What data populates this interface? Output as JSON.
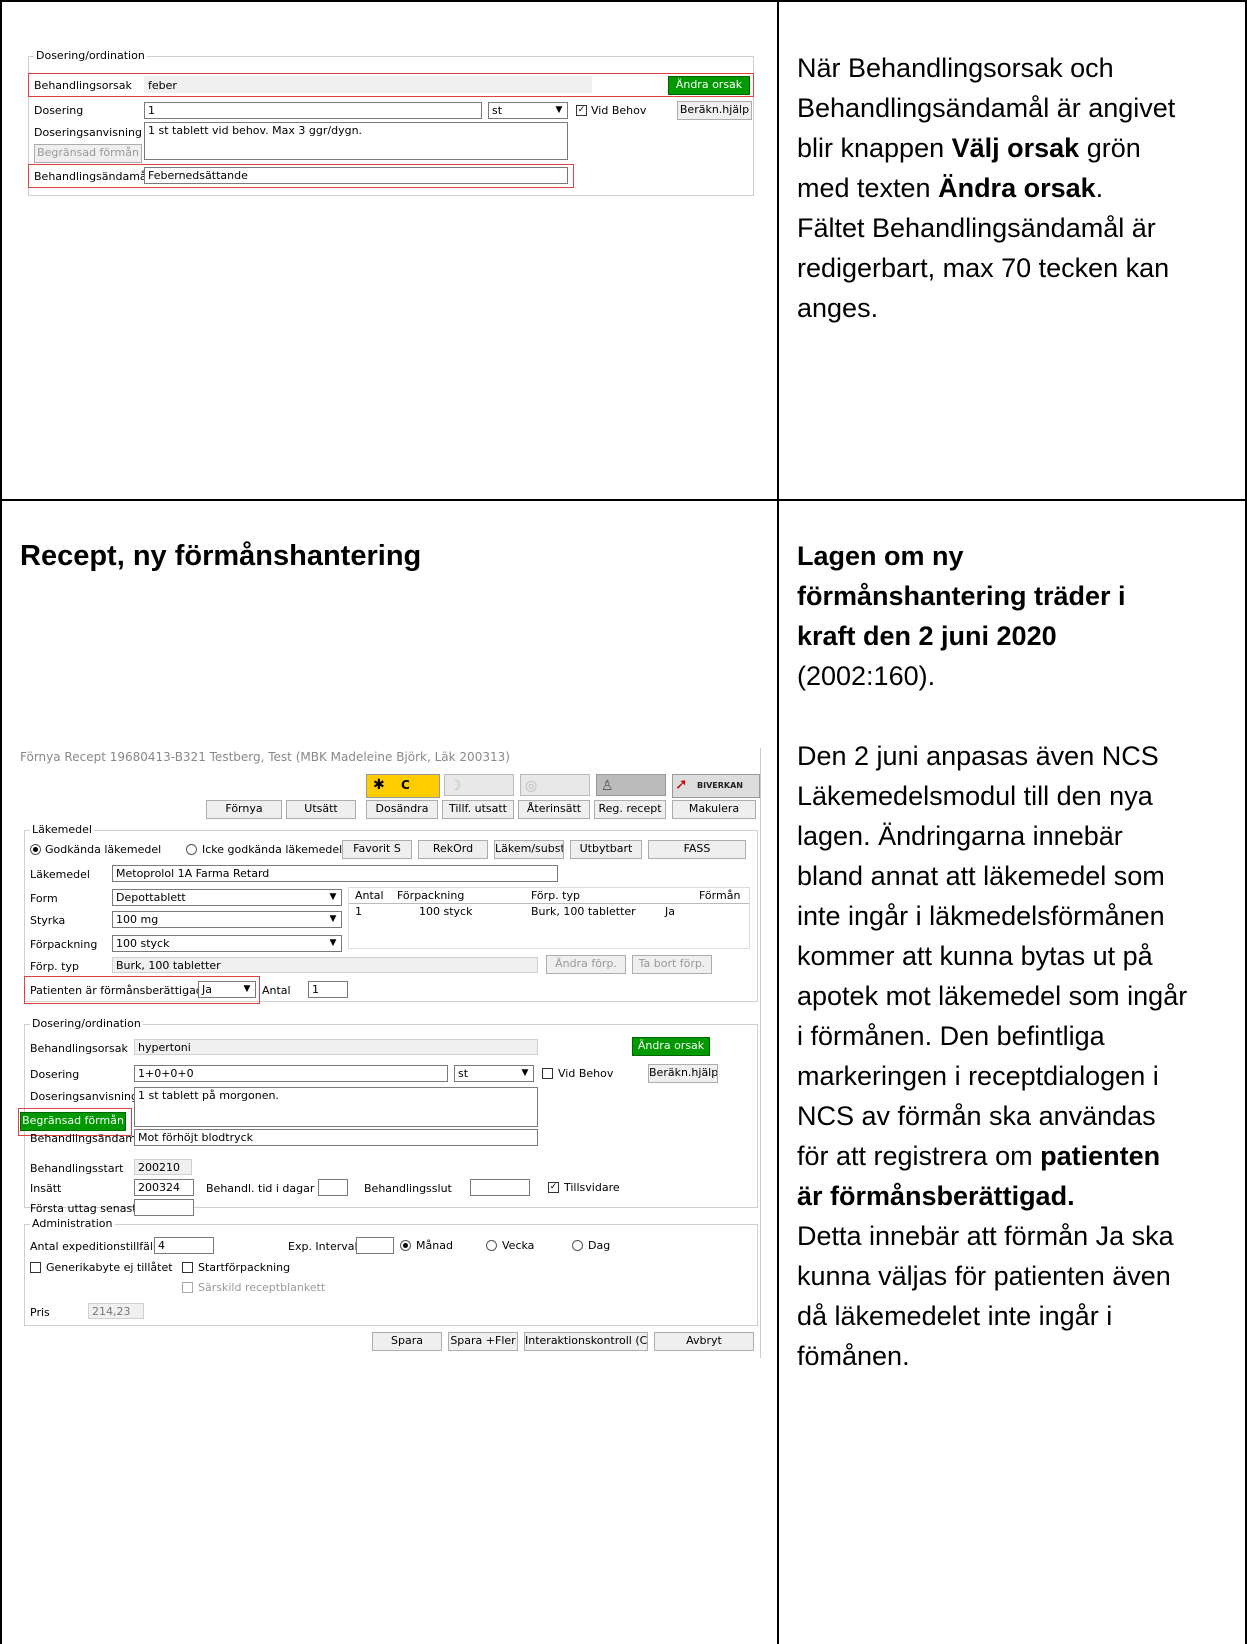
{
  "top_right_text": {
    "line1": "När Behandlingsorsak och",
    "line2": "Behandlingsändamål är angivet",
    "line3_pre": "blir knappen ",
    "line3_bold": "Välj orsak",
    "line3_post": " grön",
    "line4_pre": "med texten ",
    "line4_bold": "Ändra orsak",
    "line4_post": ".",
    "line5": "Fältet Behandlingsändamål är",
    "line6": "redigerbart, max 70 tecken kan",
    "line7": "anges."
  },
  "shot1": {
    "group_title": "Dosering/ordination",
    "behandlingsorsak_label": "Behandlingsorsak",
    "behandlingsorsak_value": "feber",
    "andra_orsak": "Ändra orsak",
    "dosering_label": "Dosering",
    "dosering_value": "1",
    "unit_value": "st",
    "vid_behov": "Vid Behov",
    "berakn": "Beräkn.hjälp",
    "doseringsanvisning_label": "Doseringsanvisning",
    "doseringsanvisning_value": "1 st tablett vid behov. Max 3 ggr/dygn.",
    "begransad": "Begränsad förmån",
    "behandlingsandamal_label": "Behandlingsändamål",
    "behandlingsandamal_value": "Febernedsättande"
  },
  "section_title": "Recept, ny förmånshantering",
  "right_text": {
    "h1": "Lagen om ny",
    "h2": "förmånshantering träder i",
    "h3": "kraft den 2 juni 2020",
    "h4": "(2002:160).",
    "p1": "Den 2 juni anpasas även NCS",
    "p2": "Läkemedelsmodul till den nya",
    "p3": "lagen. Ändringarna innebär",
    "p4": "bland annat att läkemedel som",
    "p5": "inte ingår i läkmedelsförmånen",
    "p6": "kommer att kunna bytas ut på",
    "p7": "apotek mot läkemedel som ingår",
    "p8": "i förmånen. Den befintliga",
    "p9": "markeringen i receptdialogen i",
    "p10_pre": "NCS av förmån ska användas",
    "p11_pre": "för att registrera om ",
    "p11_bold": "patienten",
    "p12_bold": "är förmånsberättigad.",
    "p13": "Detta innebär att förmån Ja ska",
    "p14": "kunna väljas för patienten även",
    "p15": "då läkemedelet inte ingår i",
    "p16": "fömånen."
  },
  "shot2": {
    "window_title": "Förnya Recept  19680413-B321 Testberg, Test (MBK Madeleine Björk, Läk 200313)",
    "icon_c": "C",
    "biverkan": "BIVERKAN",
    "toolbar": [
      "Förnya",
      "Utsätt",
      "Dosändra",
      "Tillf. utsatt",
      "Återinsätt",
      "Reg. recept",
      "Makulera"
    ],
    "lakemedel_group": "Läkemedel",
    "godkanda": "Godkända läkemedel",
    "icke_godkanda": "Icke godkända läkemedel",
    "favorit": "Favorit S",
    "rekord": "RekOrd",
    "lakem_subst": "Läkem/subst",
    "utbytbart": "Utbytbart",
    "fass": "FASS",
    "lakemedel_label": "Läkemedel",
    "lakemedel_value": "Metoprolol 1A Farma Retard",
    "form_label": "Form",
    "form_value": "Depottablett",
    "styrka_label": "Styrka",
    "styrka_value": "100 mg",
    "forpackning_label": "Förpackning",
    "forpackning_value": "100 styck",
    "forp_typ_label": "Förp. typ",
    "forp_typ_value": "Burk, 100 tabletter",
    "table_headers": [
      "Antal",
      "Förpackning",
      "Förp. typ",
      "Förmån"
    ],
    "table_row": [
      "1",
      "100 styck",
      "Burk, 100 tabletter",
      "Ja"
    ],
    "andra_forp": "Ändra förp.",
    "ta_bort_forp": "Ta bort förp.",
    "patienten_label": "Patienten är förmånsberättigad",
    "patienten_value": "Ja",
    "antal_label": "Antal",
    "antal_value": "1",
    "dos_group": "Dosering/ordination",
    "behandlingsorsak_label": "Behandlingsorsak",
    "behandlingsorsak_value": "hypertoni",
    "andra_orsak": "Ändra orsak",
    "dosering_label": "Dosering",
    "dosering_value": "1+0+0+0",
    "unit_value": "st",
    "vid_behov": "Vid Behov",
    "berakn": "Beräkn.hjälp",
    "doseringsanvisning_label": "Doseringsanvisning",
    "doseringsanvisning_value": "1 st tablett på morgonen.",
    "begransad": "Begränsad förmån",
    "behandlingsandamal_label": "Behandlingsändamål",
    "behandlingsandamal_value": "Mot förhöjt blodtryck",
    "behandlingsstart_label": "Behandlingsstart",
    "behandlingsstart_value": "200210",
    "insatt_label": "Insätt",
    "insatt_value": "200324",
    "behandl_tid_label": "Behandl. tid i dagar",
    "behandlingsslut_label": "Behandlingsslut",
    "tillsvidare": "Tillsvidare",
    "forsta_uttag_label": "Första uttag senast",
    "admin_group": "Administration",
    "antal_exp_label": "Antal expeditionstillfällen",
    "antal_exp_value": "4",
    "exp_intervall_label": "Exp. Intervall",
    "manad": "Månad",
    "vecka": "Vecka",
    "dag": "Dag",
    "generikabyte": "Generikabyte ej tillåtet",
    "startforpackning": "Startförpackning",
    "sarskild": "Särskild receptblankett",
    "pris_label": "Pris",
    "pris_value": "214,23",
    "spara": "Spara",
    "spara_fler": "Spara +Fler",
    "interaktion": "Interaktionskontroll (C)",
    "avbryt": "Avbryt"
  }
}
